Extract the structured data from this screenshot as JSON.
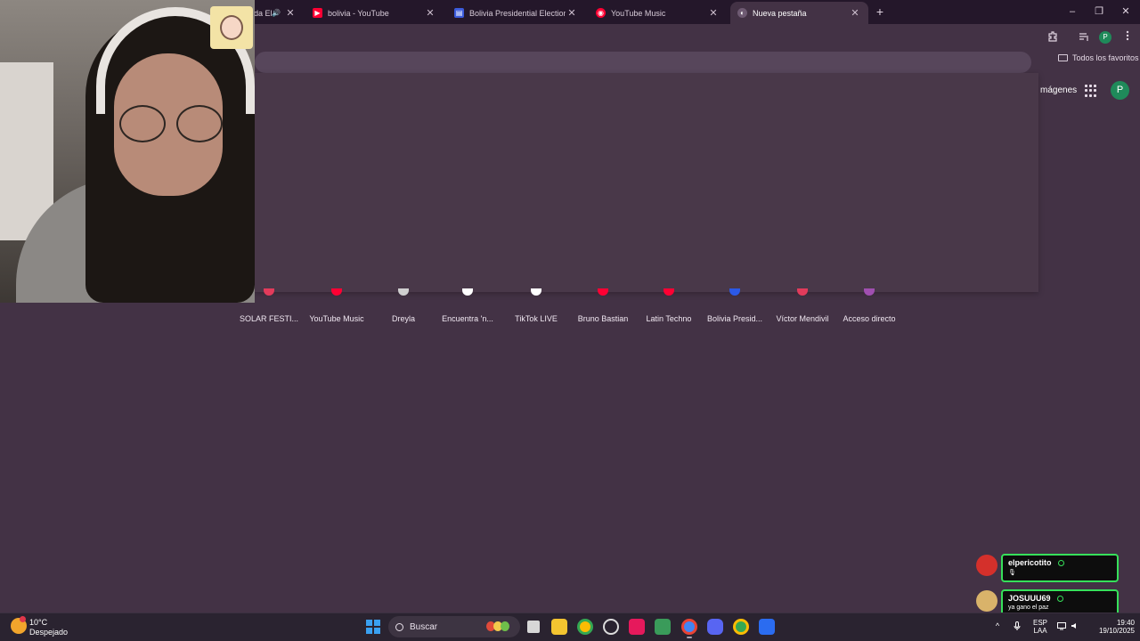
{
  "browser": {
    "tabs": [
      {
        "title": "da El",
        "favicon_color": "#5f6368",
        "favicon": "",
        "audio": true
      },
      {
        "title": "bolivia - YouTube",
        "favicon_color": "#ff0033",
        "favicon": "▶"
      },
      {
        "title": "Bolivia Presidential Election",
        "favicon_color": "#3b5bdb",
        "favicon": "▤"
      },
      {
        "title": "YouTube Music",
        "favicon_color": "#ff0033",
        "favicon": "◉"
      },
      {
        "title": "Nueva pestaña",
        "favicon_color": "#6e5a72",
        "favicon": "◐",
        "active": true
      }
    ],
    "close_glyph": "✕",
    "new_tab_glyph": "+",
    "audio_glyph": "🔊",
    "window_controls": {
      "minimize": "–",
      "maximize": "❐",
      "close": "✕"
    },
    "toolbar": {
      "profile_initial": "P"
    },
    "bookmarks_bar": {
      "all_bookmarks": "Todos los favoritos"
    },
    "ntp": {
      "images_link": "mágenes",
      "profile_initial": "P"
    }
  },
  "shortcuts": [
    {
      "label": "SOLAR FESTI...",
      "icon_color": "#e23b5b"
    },
    {
      "label": "YouTube Music",
      "icon_color": "#ff0033"
    },
    {
      "label": "Dreyla",
      "icon_color": "#cfcfcf"
    },
    {
      "label": "Encuentra 'n...",
      "icon_color": "#ffffff"
    },
    {
      "label": "TikTok LIVE",
      "icon_color": "#ffffff"
    },
    {
      "label": "Bruno Bastian",
      "icon_color": "#ff0033"
    },
    {
      "label": "Latin Techno",
      "icon_color": "#ff0033"
    },
    {
      "label": "Bolivia Presid...",
      "icon_color": "#2b59e6"
    },
    {
      "label": "Víctor Mendivil",
      "icon_color": "#e23b5b"
    },
    {
      "label": "Acceso directo",
      "icon_color": "#d07ad9"
    }
  ],
  "chat": [
    {
      "user": "elpericotito",
      "message": "🎙",
      "avatar_color": "#d4302b"
    },
    {
      "user": "JOSUUU69",
      "message": "ya gano el paz",
      "avatar_color": "#d9b36a"
    }
  ],
  "taskbar": {
    "weather": {
      "temp": "10°C",
      "condition": "Despejado"
    },
    "search_placeholder": "Buscar",
    "language": {
      "line1": "ESP",
      "line2": "LAA"
    },
    "clock": {
      "time": "19:40",
      "date": "19/10/2025"
    },
    "tray_chevron": "^"
  }
}
